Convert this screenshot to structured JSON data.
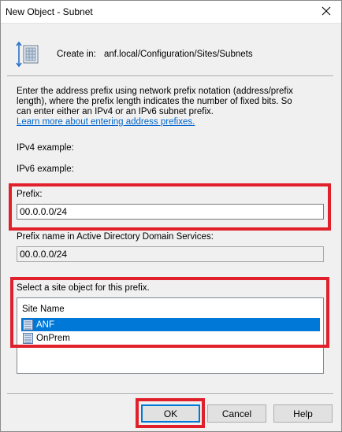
{
  "window": {
    "title": "New Object - Subnet"
  },
  "header": {
    "create_in_label": "Create in:",
    "create_in_path": "anf.local/Configuration/Sites/Subnets"
  },
  "description": {
    "lines": [
      "Enter the address prefix using network prefix notation (address/prefix",
      "length), where the prefix length indicates the number of fixed bits. So",
      "can enter either an IPv4 or an IPv6 subnet prefix."
    ],
    "link": "Learn more about entering address prefixes."
  },
  "examples": {
    "ipv4_label": "IPv4 example:",
    "ipv6_label": "IPv6 example:"
  },
  "prefix": {
    "label": "Prefix:",
    "value": "00.0.0.0/24"
  },
  "prefix_name": {
    "label": "Prefix name in Active Directory Domain Services:",
    "value": "00.0.0.0/24"
  },
  "site": {
    "label": "Select a site object for this prefix.",
    "column_header": "Site Name",
    "items": [
      {
        "name": "ANF",
        "selected": true
      },
      {
        "name": "OnPrem",
        "selected": false
      }
    ]
  },
  "buttons": {
    "ok": "OK",
    "cancel": "Cancel",
    "help": "Help"
  },
  "icons": {
    "close": "close-icon",
    "subnet": "subnet-icon",
    "site": "site-icon"
  },
  "colors": {
    "highlight": "#e0202a",
    "selection": "#0078d7",
    "link": "#0066cc"
  }
}
